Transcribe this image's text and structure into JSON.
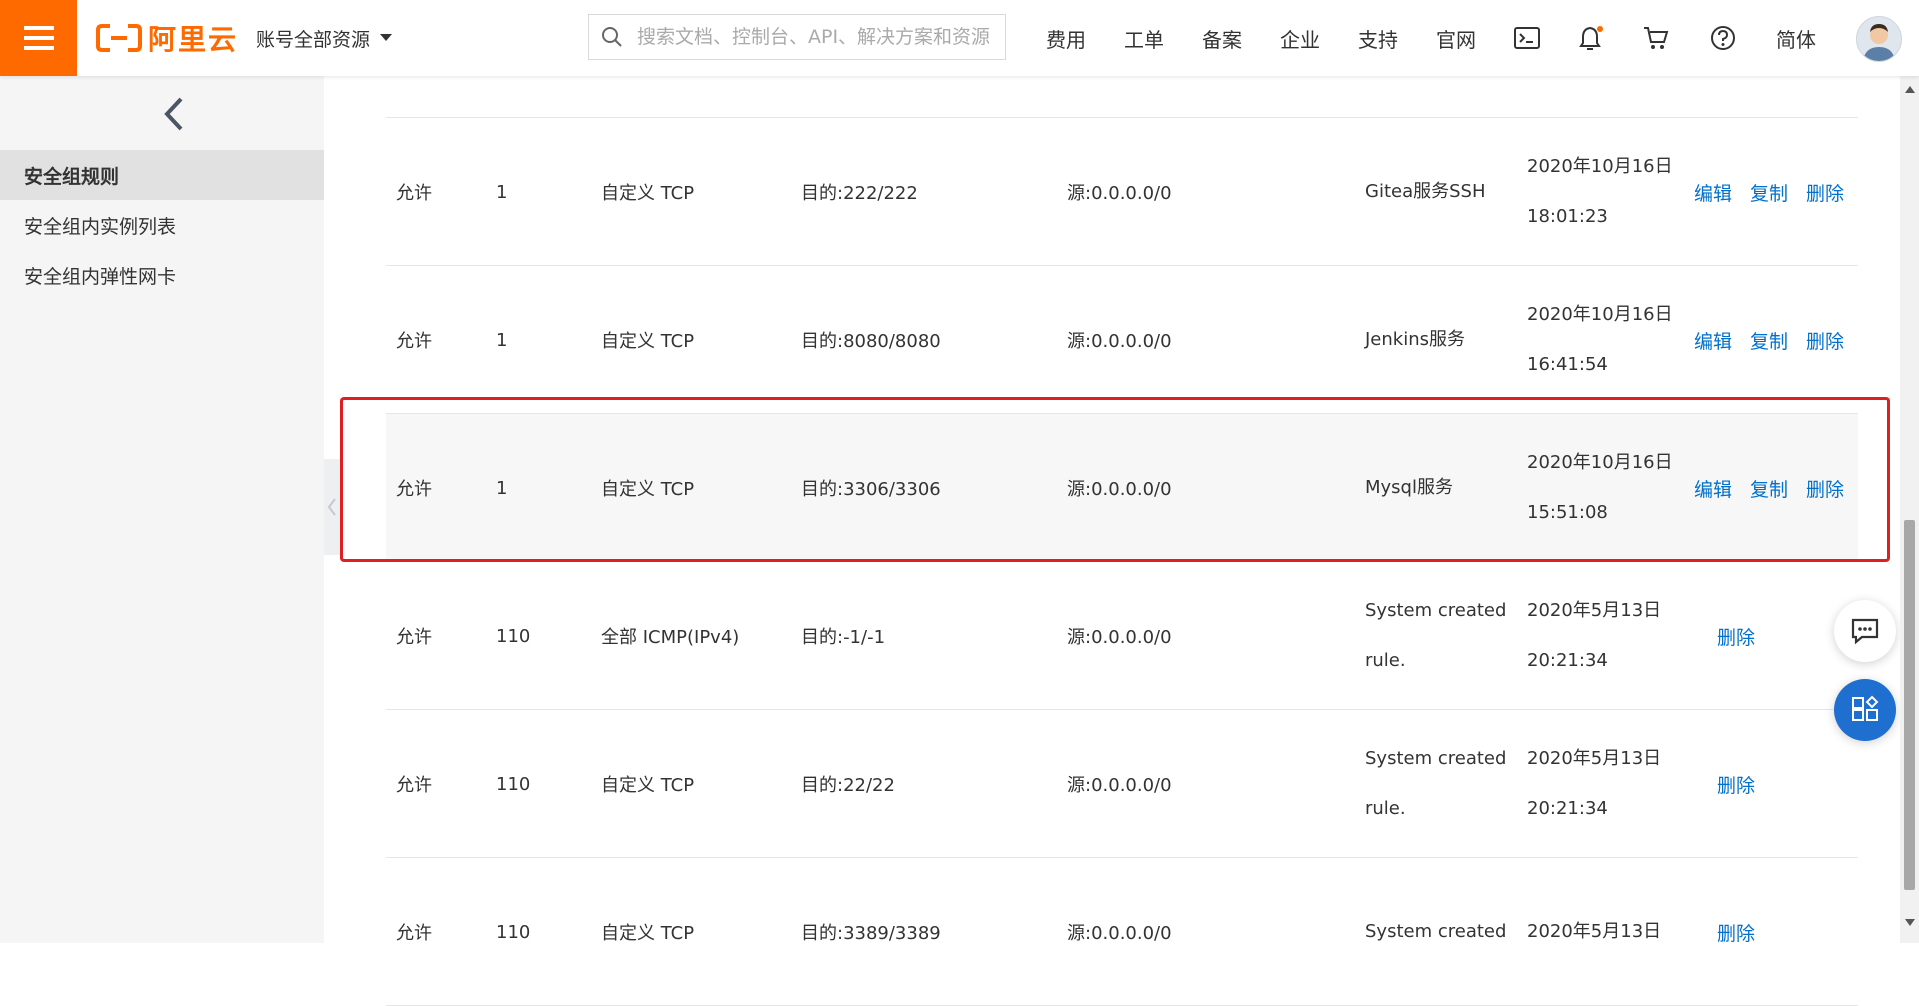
{
  "header": {
    "brand": "阿里云",
    "account": "账号全部资源",
    "search_placeholder": "搜索文档、控制台、API、解决方案和资源",
    "nav": [
      "费用",
      "工单",
      "备案",
      "企业",
      "支持",
      "官网"
    ],
    "lang": "简体"
  },
  "sidebar": {
    "items": [
      {
        "label": "安全组规则"
      },
      {
        "label": "安全组内实例列表"
      },
      {
        "label": "安全组内弹性网卡"
      }
    ]
  },
  "rules": [
    {
      "policy": "允许",
      "priority": "1",
      "protocol": "自定义 TCP",
      "port": "目的:222/222",
      "source": "源:0.0.0.0/0",
      "desc": [
        "Gitea服务SSH"
      ],
      "time": [
        "2020年10月16日",
        "18:01:23"
      ],
      "actions": [
        "编辑",
        "复制",
        "删除"
      ]
    },
    {
      "policy": "允许",
      "priority": "1",
      "protocol": "自定义 TCP",
      "port": "目的:8080/8080",
      "source": "源:0.0.0.0/0",
      "desc": [
        "Jenkins服务"
      ],
      "time": [
        "2020年10月16日",
        "16:41:54"
      ],
      "actions": [
        "编辑",
        "复制",
        "删除"
      ]
    },
    {
      "policy": "允许",
      "priority": "1",
      "protocol": "自定义 TCP",
      "port": "目的:3306/3306",
      "source": "源:0.0.0.0/0",
      "desc": [
        "Mysql服务"
      ],
      "time": [
        "2020年10月16日",
        "15:51:08"
      ],
      "actions": [
        "编辑",
        "复制",
        "删除"
      ]
    },
    {
      "policy": "允许",
      "priority": "110",
      "protocol": "全部 ICMP(IPv4)",
      "port": "目的:-1/-1",
      "source": "源:0.0.0.0/0",
      "desc": [
        "System created",
        "rule."
      ],
      "time": [
        "2020年5月13日",
        "20:21:34"
      ],
      "actions": [
        "删除"
      ]
    },
    {
      "policy": "允许",
      "priority": "110",
      "protocol": "自定义 TCP",
      "port": "目的:22/22",
      "source": "源:0.0.0.0/0",
      "desc": [
        "System created",
        "rule."
      ],
      "time": [
        "2020年5月13日",
        "20:21:34"
      ],
      "actions": [
        "删除"
      ]
    },
    {
      "policy": "允许",
      "priority": "110",
      "protocol": "自定义 TCP",
      "port": "目的:3389/3389",
      "source": "源:0.0.0.0/0",
      "desc": [
        "System created"
      ],
      "time": [
        "2020年5月13日"
      ],
      "actions": [
        "删除"
      ]
    }
  ],
  "colors": {
    "brand": "#ff6a00",
    "link": "#0070cc",
    "highlight": "#e02020",
    "fab": "#1f6fd0"
  }
}
